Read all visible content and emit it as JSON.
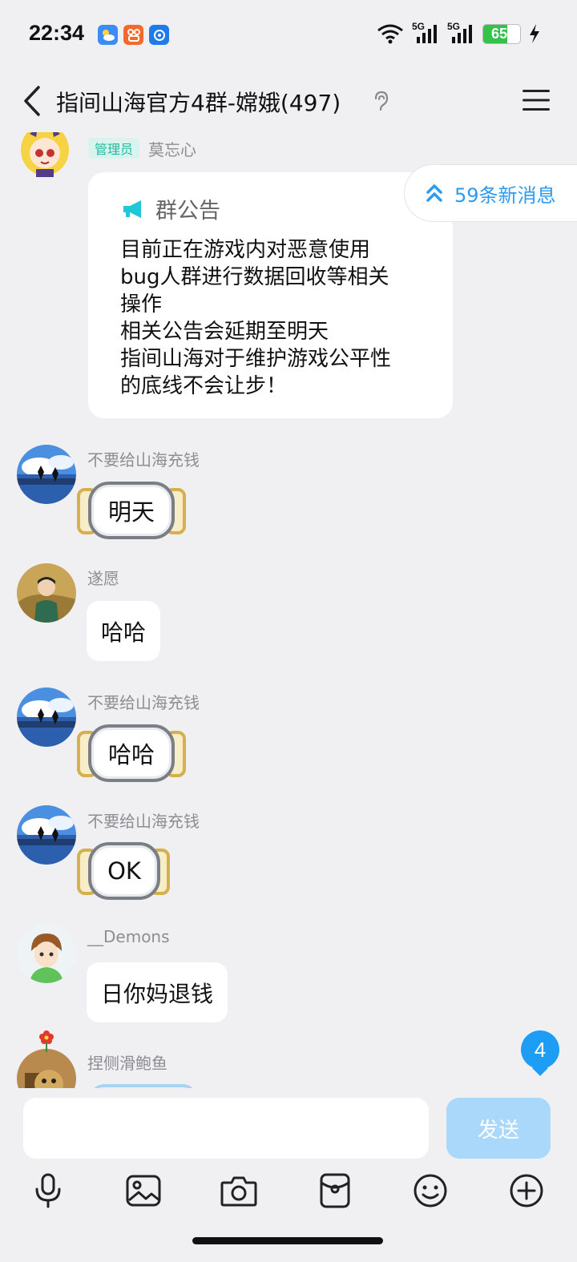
{
  "status_bar": {
    "time": "22:34",
    "network_1": "5G",
    "network_2": "5G",
    "battery": "65",
    "battery_level": 0.65
  },
  "nav": {
    "title": "指间山海官方4群-嫦娥(497)"
  },
  "new_messages": {
    "label": "59条新消息"
  },
  "announcement": {
    "sender_badge": "管理员",
    "sender_name": "莫忘心",
    "title": "群公告",
    "lines": [
      "目前正在游戏内对恶意使用",
      "bug人群进行数据回收等相关",
      "操作",
      "相关公告会延期至明天",
      "指间山海对于维护游戏公平性",
      "的底线不会让步！"
    ]
  },
  "messages": [
    {
      "sender": "不要给山海充钱",
      "text": "明天"
    },
    {
      "sender": "遂愿",
      "text": "哈哈"
    },
    {
      "sender": "不要给山海充钱",
      "text": "哈哈"
    },
    {
      "sender": "不要给山海充钱",
      "text": "OK"
    },
    {
      "sender": "__Demons",
      "text": "日你妈退钱"
    },
    {
      "sender": "捏侧滑鲍鱼",
      "text": ""
    }
  ],
  "unread_count": "4",
  "input": {
    "value": "",
    "send_label": "发送"
  },
  "colors": {
    "accent": "#2d9bf0",
    "send_disabled": "#a9d8fb",
    "admin_badge": "#22b8a0",
    "background": "#f0f0f2"
  }
}
